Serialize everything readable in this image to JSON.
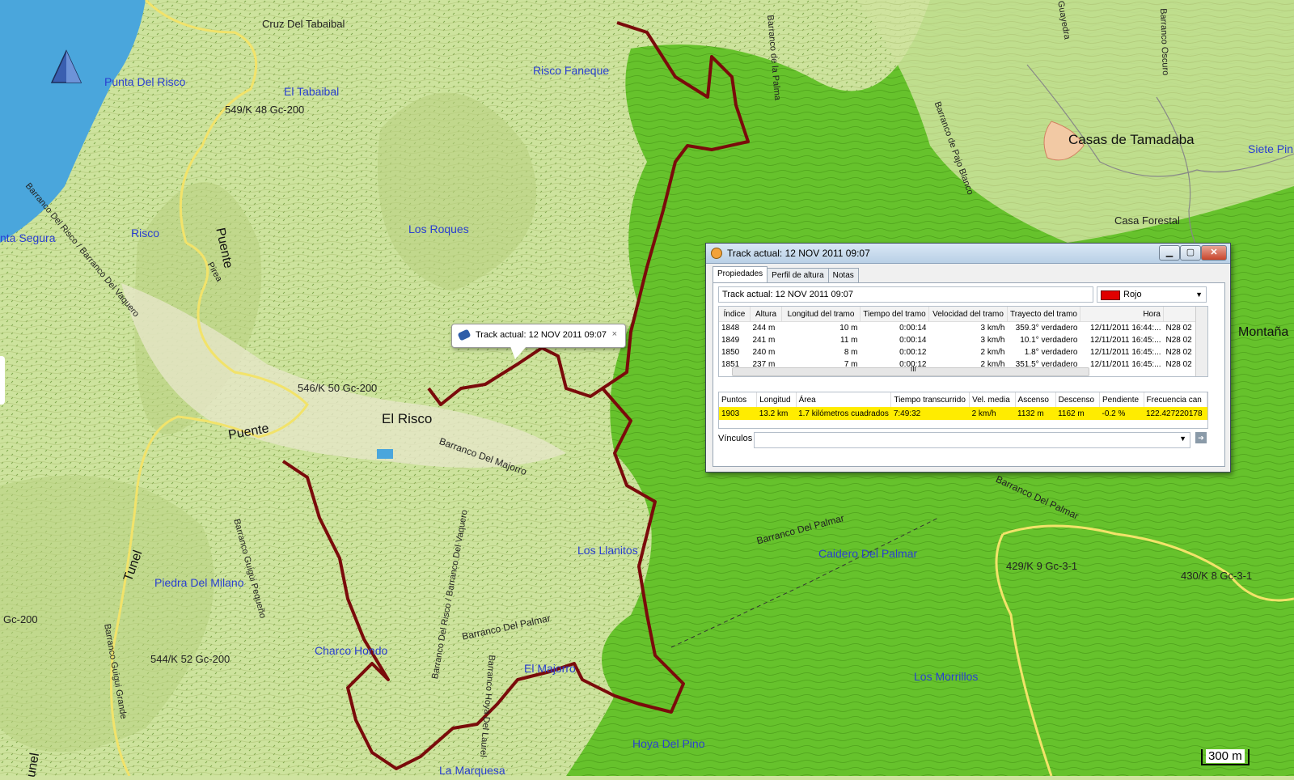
{
  "map": {
    "place_labels": [
      {
        "text": "Cruz Del Tabaibal",
        "style": "black"
      },
      {
        "text": "Punta Del Risco",
        "style": "blue"
      },
      {
        "text": "El Tabaibal",
        "style": "blue"
      },
      {
        "text": "549/K 48 Gc-200",
        "style": "black"
      },
      {
        "text": "Risco Faneque",
        "style": "blue"
      },
      {
        "text": "Risco",
        "style": "blue"
      },
      {
        "text": "nta Segura",
        "style": "blue"
      },
      {
        "text": "Los Roques",
        "style": "blue"
      },
      {
        "text": "Puente",
        "style": "place"
      },
      {
        "text": "Pirea",
        "style": "black"
      },
      {
        "text": "Barranco Del Risco / Barranco Del Vaquero",
        "style": "black"
      },
      {
        "text": "546/K 50 Gc-200",
        "style": "black"
      },
      {
        "text": "El Risco",
        "style": "big"
      },
      {
        "text": "Puente",
        "style": "place"
      },
      {
        "text": "Barranco Del Majorro",
        "style": "black"
      },
      {
        "text": "Tunel",
        "style": "place"
      },
      {
        "text": "Piedra Del Milano",
        "style": "blue"
      },
      {
        "text": "Barranco Guigui Pequeño",
        "style": "black"
      },
      {
        "text": "Barranco Del Risco / Barranco Del Vaquero",
        "style": "black"
      },
      {
        "text": "Los Llanitos",
        "style": "blue"
      },
      {
        "text": "Barranco Del Palmar",
        "style": "black"
      },
      {
        "text": "Gc-200",
        "style": "black"
      },
      {
        "text": "Barranco Guigui Grande",
        "style": "black"
      },
      {
        "text": "544/K 52 Gc-200",
        "style": "black"
      },
      {
        "text": "Charco Hondo",
        "style": "blue"
      },
      {
        "text": "El Majorro",
        "style": "blue"
      },
      {
        "text": "Barranco Hoya Del Laurel",
        "style": "black"
      },
      {
        "text": "Hoya Del Pino",
        "style": "blue"
      },
      {
        "text": "La Marquesa",
        "style": "blue"
      },
      {
        "text": "unel",
        "style": "place"
      },
      {
        "text": "Barranco de la Palma",
        "style": "black"
      },
      {
        "text": "Barranco de Pajo Blanco",
        "style": "black"
      },
      {
        "text": "Casas de Tamadaba",
        "style": "big"
      },
      {
        "text": "Siete Pin",
        "style": "blue"
      },
      {
        "text": "Casa Forestal",
        "style": "black"
      },
      {
        "text": "Montaña",
        "style": "place"
      },
      {
        "text": "Barranco Del Palmar",
        "style": "black"
      },
      {
        "text": "Barranco Del Palmar",
        "style": "black"
      },
      {
        "text": "Caidero Del Palmar",
        "style": "blue"
      },
      {
        "text": "429/K 9 Gc-3-1",
        "style": "black"
      },
      {
        "text": "430/K 8 Gc-3-1",
        "style": "black"
      },
      {
        "text": "Los Morrillos",
        "style": "blue"
      },
      {
        "text": "Guayedra",
        "style": "black"
      },
      {
        "text": "Barranco Oscuro",
        "style": "black"
      }
    ],
    "scale_label": "300 m",
    "tooltip": {
      "text": "Track actual: 12 NOV 2011 09:07",
      "close": "×"
    }
  },
  "window": {
    "title": "Track actual: 12 NOV 2011 09:07",
    "controls": {
      "minimize": "▁",
      "maximize": "▢",
      "close": "✕"
    },
    "tabs": [
      "Propiedades",
      "Perfil de altura",
      "Notas"
    ],
    "track_name": "Track actual: 12 NOV 2011 09:07",
    "color": {
      "label": "Rojo",
      "value": "#e00000"
    },
    "points_table": {
      "headers": [
        "Índice",
        "Altura",
        "Longitud del tramo",
        "Tiempo del tramo",
        "Velocidad del tramo",
        "Trayecto del tramo",
        "Hora",
        ""
      ],
      "rows": [
        [
          "1848",
          "244 m",
          "10 m",
          "0:00:14",
          "3 km/h",
          "359.3° verdadero",
          "12/11/2011 16:44:...",
          "N28 02"
        ],
        [
          "1849",
          "241 m",
          "11 m",
          "0:00:14",
          "3 km/h",
          "10.1° verdadero",
          "12/11/2011 16:45:...",
          "N28 02"
        ],
        [
          "1850",
          "240 m",
          "8 m",
          "0:00:12",
          "2 km/h",
          "1.8° verdadero",
          "12/11/2011 16:45:...",
          "N28 02"
        ],
        [
          "1851",
          "237 m",
          "7 m",
          "0:00:12",
          "2 km/h",
          "351.5° verdadero",
          "12/11/2011 16:45:...",
          "N28 02"
        ]
      ],
      "scroll_marker": "III"
    },
    "summary_table": {
      "headers": [
        "Puntos",
        "Longitud",
        "Área",
        "Tiempo transcurrido",
        "Vel. media",
        "Ascenso",
        "Descenso",
        "Pendiente",
        "Frecuencia can"
      ],
      "row": [
        "1903",
        "13.2 km",
        "1.7 kilómetros cuadrados",
        "7:49:32",
        "2 km/h",
        "1132 m",
        "1162 m",
        "-0.2 %",
        "122.427220178"
      ],
      "highlight_color": "#ffec00"
    },
    "links_label": "Vínculos"
  },
  "colors": {
    "track": "#7a0b0b",
    "sea": "#4aa6dc",
    "forest": "#63c22a",
    "terrain": "#c8df98"
  }
}
